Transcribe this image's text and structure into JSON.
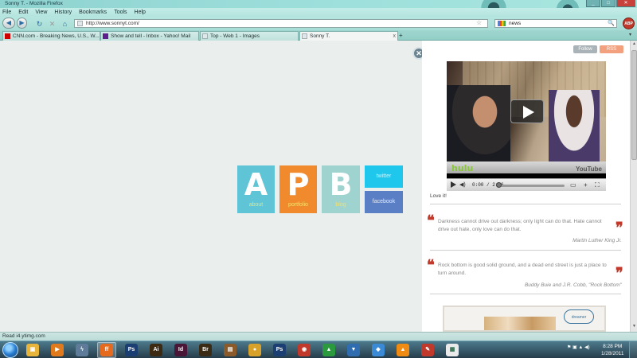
{
  "window": {
    "title": "Sonny T. - Mozilla Firefox",
    "min": "_",
    "max": "□",
    "close": "✕"
  },
  "menu": [
    "File",
    "Edit",
    "View",
    "History",
    "Bookmarks",
    "Tools",
    "Help"
  ],
  "nav": {
    "url": "http://www.sonnyt.com/",
    "search_value": "news",
    "back": "◀",
    "forward": "▶",
    "reload": "↻",
    "stop": "✕",
    "home": "⌂",
    "star": "☆",
    "search_icon": "🔍",
    "abp_label": "ABP"
  },
  "tabs": [
    {
      "label": "CNN.com - Breaking News, U.S., W...",
      "icon": "cnn-icon",
      "color": "#cc0000",
      "active": false
    },
    {
      "label": "Show and tell - Inbox - Yahoo! Mail",
      "icon": "yahoo-icon",
      "color": "#5f1f8d",
      "active": false
    },
    {
      "label": "Top - Web 1 - Images",
      "icon": "page-icon",
      "color": "#dfe7ea",
      "active": false
    },
    {
      "label": "Sonny T.",
      "icon": "page-icon",
      "color": "#dfe7ea",
      "active": true
    }
  ],
  "tab_close": "x",
  "new_tab": "+",
  "tab_list": "▾",
  "page": {
    "close_icon_glyph": "✕",
    "tiles": {
      "about": {
        "letter": "A",
        "label": "about",
        "color": "#5fc4d6"
      },
      "portfolio": {
        "letter": "P",
        "label": "portfolio",
        "color": "#f08a2c"
      },
      "blog": {
        "letter": "B",
        "label": "blog",
        "color": "#9fd3cf"
      },
      "twitter": {
        "label": "twitter",
        "color": "#1fc7ec"
      },
      "facebook": {
        "label": "facebook",
        "color": "#5a7fc4"
      }
    }
  },
  "panel": {
    "follow": "Follow",
    "rss": "RSS",
    "video": {
      "brand": "hulu",
      "yt": "YouTube",
      "time": "0:00 / 2:56",
      "volume": "◀)",
      "fullscreen": "⛶",
      "plus": "+",
      "progress": 0
    },
    "caption": "Love it!",
    "quotes": [
      {
        "text": "Darkness cannot drive out darkness; only light can do that. Hate cannot drive out hate, only love can do that.",
        "author": "Martin Luther King Jr."
      },
      {
        "text": "Rock bottom is good solid ground, and a dead end street is just a place to turn around.",
        "author": "Buddy Buie and J.R. Cobb, \"Rock Bottom\""
      }
    ],
    "quote_open": "❝",
    "quote_close": "❞",
    "ad_brand": "dreamer"
  },
  "status": "Read i4.ytimg.com",
  "taskbar": {
    "apps": [
      {
        "name": "explorer-icon",
        "glyph": "▣",
        "color": "#e8b53c"
      },
      {
        "name": "media-player-icon",
        "glyph": "▶",
        "color": "#e07a1c"
      },
      {
        "name": "finder-icon",
        "glyph": "ϟ",
        "color": "#5e7c9a"
      },
      {
        "name": "firefox-icon",
        "glyph": "ff",
        "color": "#e66a1d",
        "active": true
      },
      {
        "name": "photoshop-icon",
        "glyph": "Ps",
        "color": "#1c3f73"
      },
      {
        "name": "illustrator-icon",
        "glyph": "Ai",
        "color": "#3c2a12"
      },
      {
        "name": "indesign-icon",
        "glyph": "Id",
        "color": "#4a1637"
      },
      {
        "name": "bridge-icon",
        "glyph": "Br",
        "color": "#3b2a14"
      },
      {
        "name": "archive-icon",
        "glyph": "▤",
        "color": "#8a5a2a"
      },
      {
        "name": "chat-icon",
        "glyph": "●",
        "color": "#d8a12a"
      },
      {
        "name": "photoshop2-icon",
        "glyph": "Ps",
        "color": "#1c3f73"
      },
      {
        "name": "chrome-icon",
        "glyph": "◉",
        "color": "#c0392b"
      },
      {
        "name": "upload-icon",
        "glyph": "▲",
        "color": "#2b9a3e"
      },
      {
        "name": "download-icon",
        "glyph": "▼",
        "color": "#2f6db0"
      },
      {
        "name": "shield-icon",
        "glyph": "◆",
        "color": "#3a8ad6"
      },
      {
        "name": "vlc-icon",
        "glyph": "▲",
        "color": "#ef8a12"
      },
      {
        "name": "tool-icon",
        "glyph": "✎",
        "color": "#c0392b"
      },
      {
        "name": "notes-icon",
        "glyph": "▦",
        "color": "#eaeaea"
      }
    ],
    "time": "8:28 PM",
    "date": "1/28/2011",
    "tray": "⚑ ▣ ▲ ◀)"
  }
}
